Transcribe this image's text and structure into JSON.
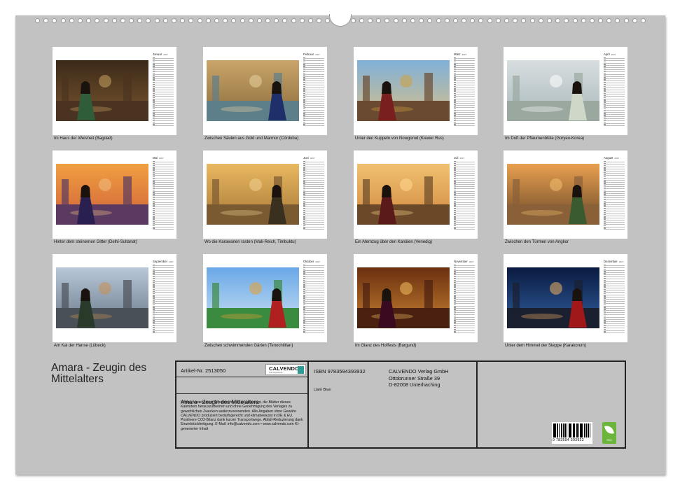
{
  "months": [
    {
      "name": "Januar",
      "year": "2027",
      "caption": "Im Haus der Weisheit (Bagdad)"
    },
    {
      "name": "Februar",
      "year": "2027",
      "caption": "Zwischen Säulen aus Gold und Marmor (Córdoba)"
    },
    {
      "name": "März",
      "year": "2027",
      "caption": "Unter den Kuppeln von Nowgorod (Kiewer Rus)"
    },
    {
      "name": "April",
      "year": "2027",
      "caption": "Im Duft der Pflaumenblüte (Goryeo-Korea)"
    },
    {
      "name": "Mai",
      "year": "2027",
      "caption": "Hinter dem steinernen Gitter (Delhi-Sultanat)"
    },
    {
      "name": "Juni",
      "year": "2027",
      "caption": "Wo die Karawanen rasten (Mali-Reich, Timbuktu)"
    },
    {
      "name": "Juli",
      "year": "2027",
      "caption": "Ein Atemzug über den Kanälen (Venedig)"
    },
    {
      "name": "August",
      "year": "2027",
      "caption": "Zwischen den Türmen von Angkor"
    },
    {
      "name": "September",
      "year": "2027",
      "caption": "Am Kai der Hanse (Lübeck)"
    },
    {
      "name": "Oktober",
      "year": "2027",
      "caption": "Zwischen schwimmenden Gärten (Tenochtitlan)"
    },
    {
      "name": "November",
      "year": "2027",
      "caption": "Im Glanz des Hoffests (Burgund)"
    },
    {
      "name": "Dezember",
      "year": "2027",
      "caption": "Unter dem Himmel der Steppe (Karakorum)"
    }
  ],
  "cover": {
    "title": "Amara - Zeugin des Mittelalters"
  },
  "info": {
    "article": "Artikel-Nr. 2513050",
    "logo_text": "CALVENDO",
    "logo_sub": "Gute Augenblicke",
    "name": "Amara - Zeugin des Mittelalters",
    "legal": "Infolge bestehender Schutzrechte ist es untersagt, die Blätter dieses Kalenders herauszutrennen und ohne Genehmigung des Verlages zu gewerblichen Zwecken weiterzuverwenden. Alle Angaben ohne Gewähr. CALVENDO produziert bedarfsgerecht und klimabewusst in DE & EU. Positivere CO2-Bilanz dank kurzer Transportwege. Abfall-Reduzierung dank Einzelstückfertigung. E-Mail: info@calvendo.com • www.calvendo.com KI-generierter Inhalt",
    "isbn": "ISBN 9783594393932",
    "author": "Liam Blue",
    "publisher_line1": "CALVENDO Verlag GmbH",
    "publisher_line2": "Ottobrunner Straße 39",
    "publisher_line3": "D-82008 Unterhaching",
    "barcode_number": "9 783594 393932",
    "eco_label": "eco"
  },
  "colors": {
    "board": "#c2c2c2",
    "frame": "#222222",
    "logo_accent": "#2d9c95",
    "eco_green": "#6bb53a"
  }
}
